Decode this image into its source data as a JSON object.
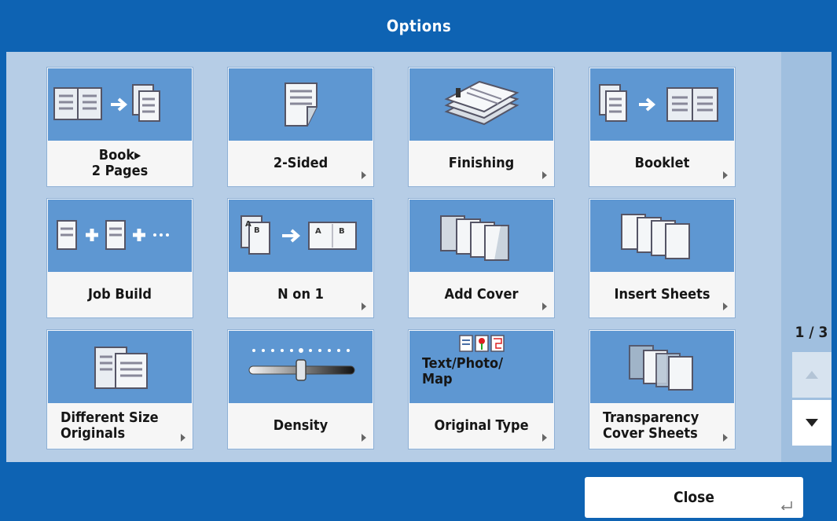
{
  "header": {
    "title": "Options"
  },
  "tiles": [
    {
      "label": "Book▸\n2 Pages",
      "icon": "book-to-2-pages-icon"
    },
    {
      "label": "2-Sided",
      "icon": "two-sided-icon"
    },
    {
      "label": "Finishing",
      "icon": "finishing-stack-icon"
    },
    {
      "label": "Booklet",
      "icon": "booklet-icon"
    },
    {
      "label": "Job Build",
      "icon": "job-build-icon"
    },
    {
      "label": "N on 1",
      "icon": "n-on-1-icon"
    },
    {
      "label": "Add Cover",
      "icon": "add-cover-icon"
    },
    {
      "label": "Insert Sheets",
      "icon": "insert-sheets-icon"
    },
    {
      "label": "Different Size\nOriginals",
      "icon": "different-size-originals-icon"
    },
    {
      "label": "Density",
      "icon": "density-slider-icon"
    },
    {
      "label": "Original Type",
      "icon": "original-type-icon",
      "current": "Text/Photo/\nMap"
    },
    {
      "label": "Transparency\nCover Sheets",
      "icon": "transparency-cover-sheets-icon"
    }
  ],
  "pager": {
    "page": "1 / 3"
  },
  "footer": {
    "close_label": "Close"
  },
  "colors": {
    "header": "#0e63b3",
    "panel": "#b6cde6",
    "icon_bg": "#5e97d2",
    "tile_label_bg": "#f6f6f6"
  }
}
